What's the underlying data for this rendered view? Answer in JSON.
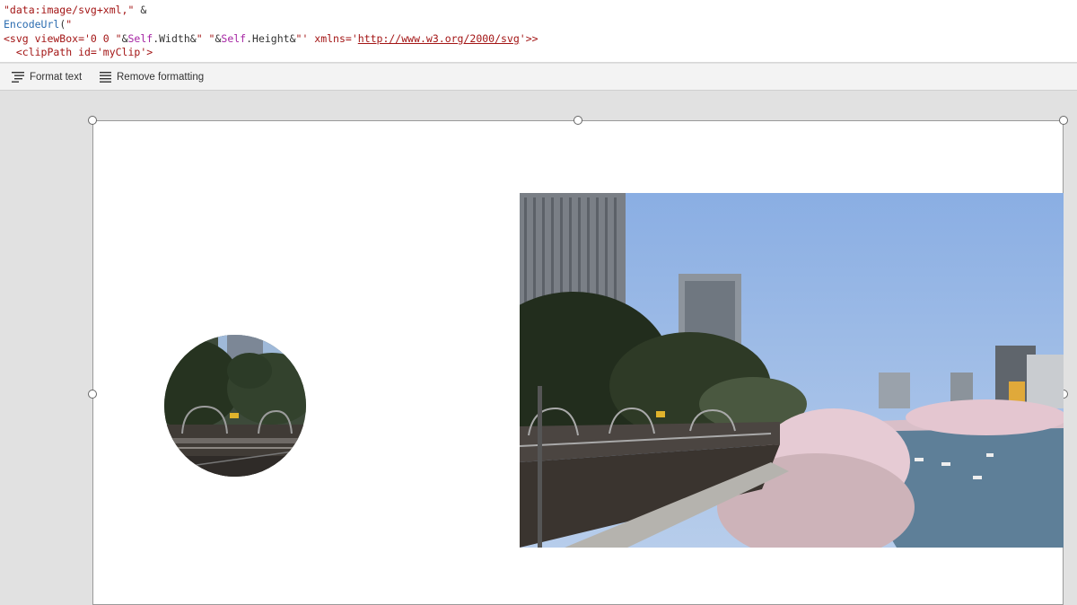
{
  "formula": {
    "line1": {
      "str": "\"data:image/svg+xml,\"",
      "op": " &"
    },
    "line2": {
      "fn": "EncodeUrl",
      "paren": "(",
      "str": "\""
    },
    "line3": {
      "a": "<svg viewBox='0 0 \"",
      "amp1": "&",
      "self1": "Self",
      "w": ".Width",
      "amp2": "&",
      "b": "\" \"",
      "amp3": "&",
      "self2": "Self",
      "h": ".Height",
      "amp4": "&",
      "c": "\"' xmlns='",
      "url": "http://www.w3.org/2000/svg",
      "d": "'>>"
    },
    "line4": "  <clipPath id='myClip'>"
  },
  "toolbar": {
    "format_text_label": "Format text",
    "remove_formatting_label": "Remove formatting"
  },
  "colors": {
    "sky": "#8fb2e4",
    "water": "#5d7f99",
    "blossom": "#e8c9d2"
  }
}
